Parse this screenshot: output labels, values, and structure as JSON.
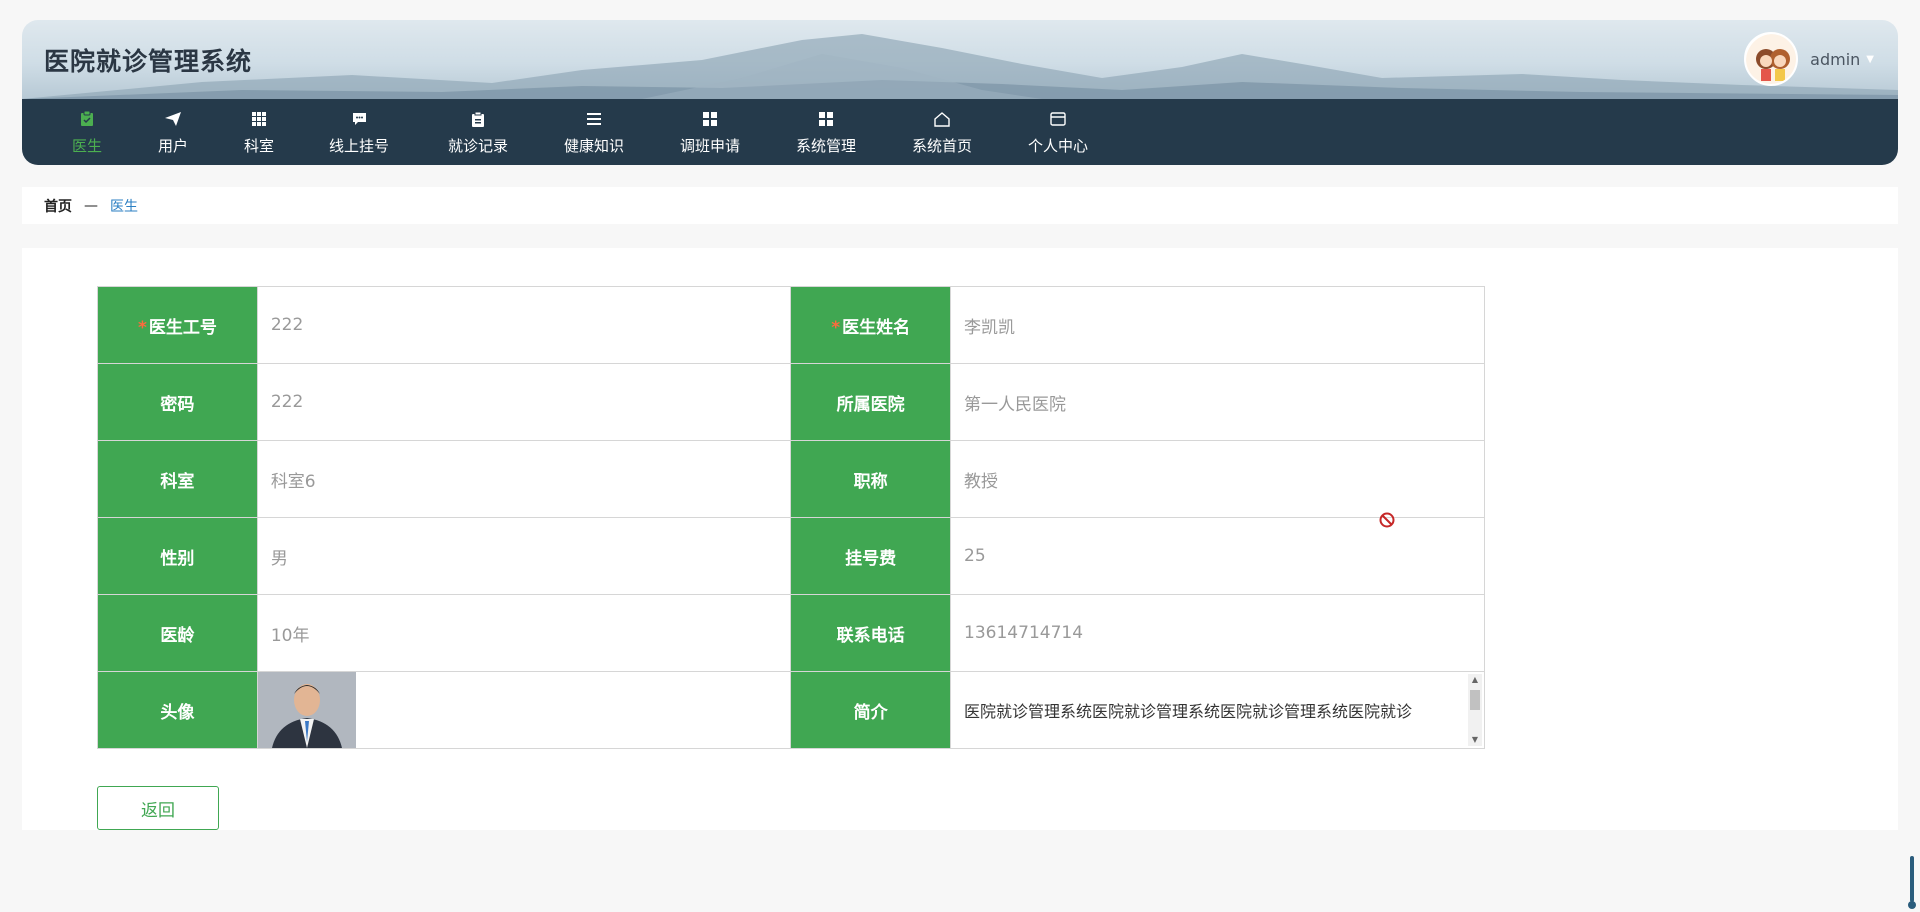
{
  "app": {
    "title": "医院就诊管理系统",
    "user": "admin"
  },
  "nav": [
    {
      "label": "医生",
      "icon": "clipboard-icon",
      "active": true
    },
    {
      "label": "用户",
      "icon": "send-icon"
    },
    {
      "label": "科室",
      "icon": "grid-icon"
    },
    {
      "label": "线上挂号",
      "icon": "comment-icon"
    },
    {
      "label": "就诊记录",
      "icon": "clipboard-icon"
    },
    {
      "label": "健康知识",
      "icon": "list-icon"
    },
    {
      "label": "调班申请",
      "icon": "apps-icon"
    },
    {
      "label": "系统管理",
      "icon": "apps-icon"
    },
    {
      "label": "系统首页",
      "icon": "home-icon"
    },
    {
      "label": "个人中心",
      "icon": "window-icon"
    }
  ],
  "breadcrumb": {
    "home": "首页",
    "sep": "—",
    "current": "医生"
  },
  "form": {
    "rows": [
      [
        {
          "label": "医生工号",
          "required": true,
          "value": "222"
        },
        {
          "label": "医生姓名",
          "required": true,
          "value": "李凯凯"
        }
      ],
      [
        {
          "label": "密码",
          "value": "222"
        },
        {
          "label": "所属医院",
          "value": "第一人民医院"
        }
      ],
      [
        {
          "label": "科室",
          "value": "科室6"
        },
        {
          "label": "职称",
          "value": "教授"
        }
      ],
      [
        {
          "label": "性别",
          "value": "男"
        },
        {
          "label": "挂号费",
          "value": "25"
        }
      ],
      [
        {
          "label": "医龄",
          "value": "10年"
        },
        {
          "label": "联系电话",
          "value": "13614714714"
        }
      ]
    ],
    "avatar_label": "头像",
    "intro_label": "简介",
    "intro_value": "医院就诊管理系统医院就诊管理系统医院就诊管理系统医院就诊",
    "required_mark": "*"
  },
  "actions": {
    "back_label": "返回"
  },
  "colors": {
    "accent": "#40a752",
    "nav_bg": "#253a4b",
    "link": "#2b7fc3"
  }
}
